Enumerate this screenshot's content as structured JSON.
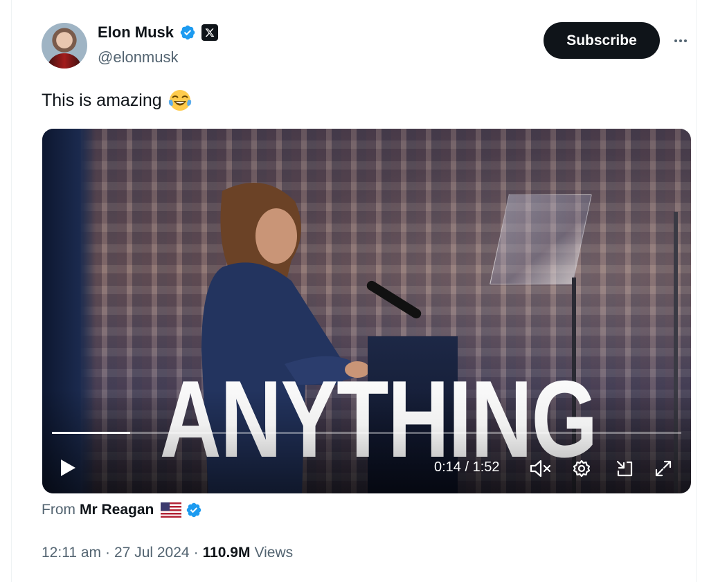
{
  "author": {
    "name": "Elon Musk",
    "handle": "@elonmusk",
    "verified_color": "#1d9bf0",
    "affiliate_badge": "x-logo-icon"
  },
  "actions": {
    "subscribe_label": "Subscribe",
    "more_icon": "more-horizontal-icon"
  },
  "tweet": {
    "text": "This is amazing",
    "emoji": "😂"
  },
  "video": {
    "overlay_text": "ANYTHING",
    "progress_fraction": 0.124,
    "time_display": "0:14 / 1:52",
    "controls": {
      "play_icon": "play-icon",
      "mute_icon": "volume-muted-icon",
      "settings_icon": "gear-icon",
      "dock_icon": "dock-icon",
      "fullscreen_icon": "expand-icon"
    }
  },
  "source": {
    "from_label": "From",
    "name": "Mr Reagan",
    "flag": "us-flag-icon"
  },
  "meta": {
    "time": "12:11 am",
    "date": "27 Jul 2024",
    "views_count": "110.9M",
    "views_label": "Views",
    "separator": "·"
  }
}
